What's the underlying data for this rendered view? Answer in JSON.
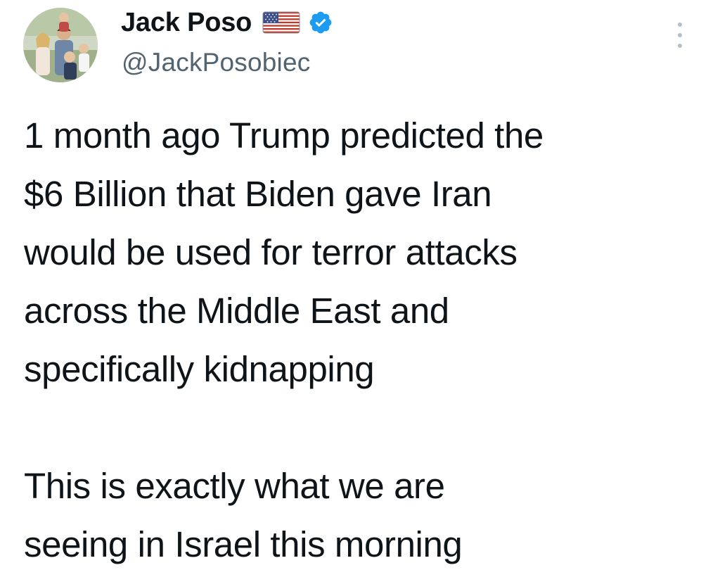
{
  "author": {
    "display_name": "Jack Poso",
    "handle": "@JackPosobiec",
    "flag_icon": "us-flag-icon",
    "verified_icon": "verified-badge-icon",
    "verified_color": "#1d9bf0"
  },
  "menu": {
    "icon": "more-options-icon"
  },
  "tweet": {
    "paragraph_1": [
      "1 month ago Trump predicted the",
      "$6 Billion that Biden gave Iran",
      "would be used for terror attacks",
      "across the Middle East and",
      "specifically kidnapping"
    ],
    "paragraph_2": [
      "This is exactly what we are",
      "seeing in Israel this morning"
    ]
  },
  "colors": {
    "text": "#0f1419",
    "secondary_text": "#536471",
    "background": "#ffffff"
  }
}
